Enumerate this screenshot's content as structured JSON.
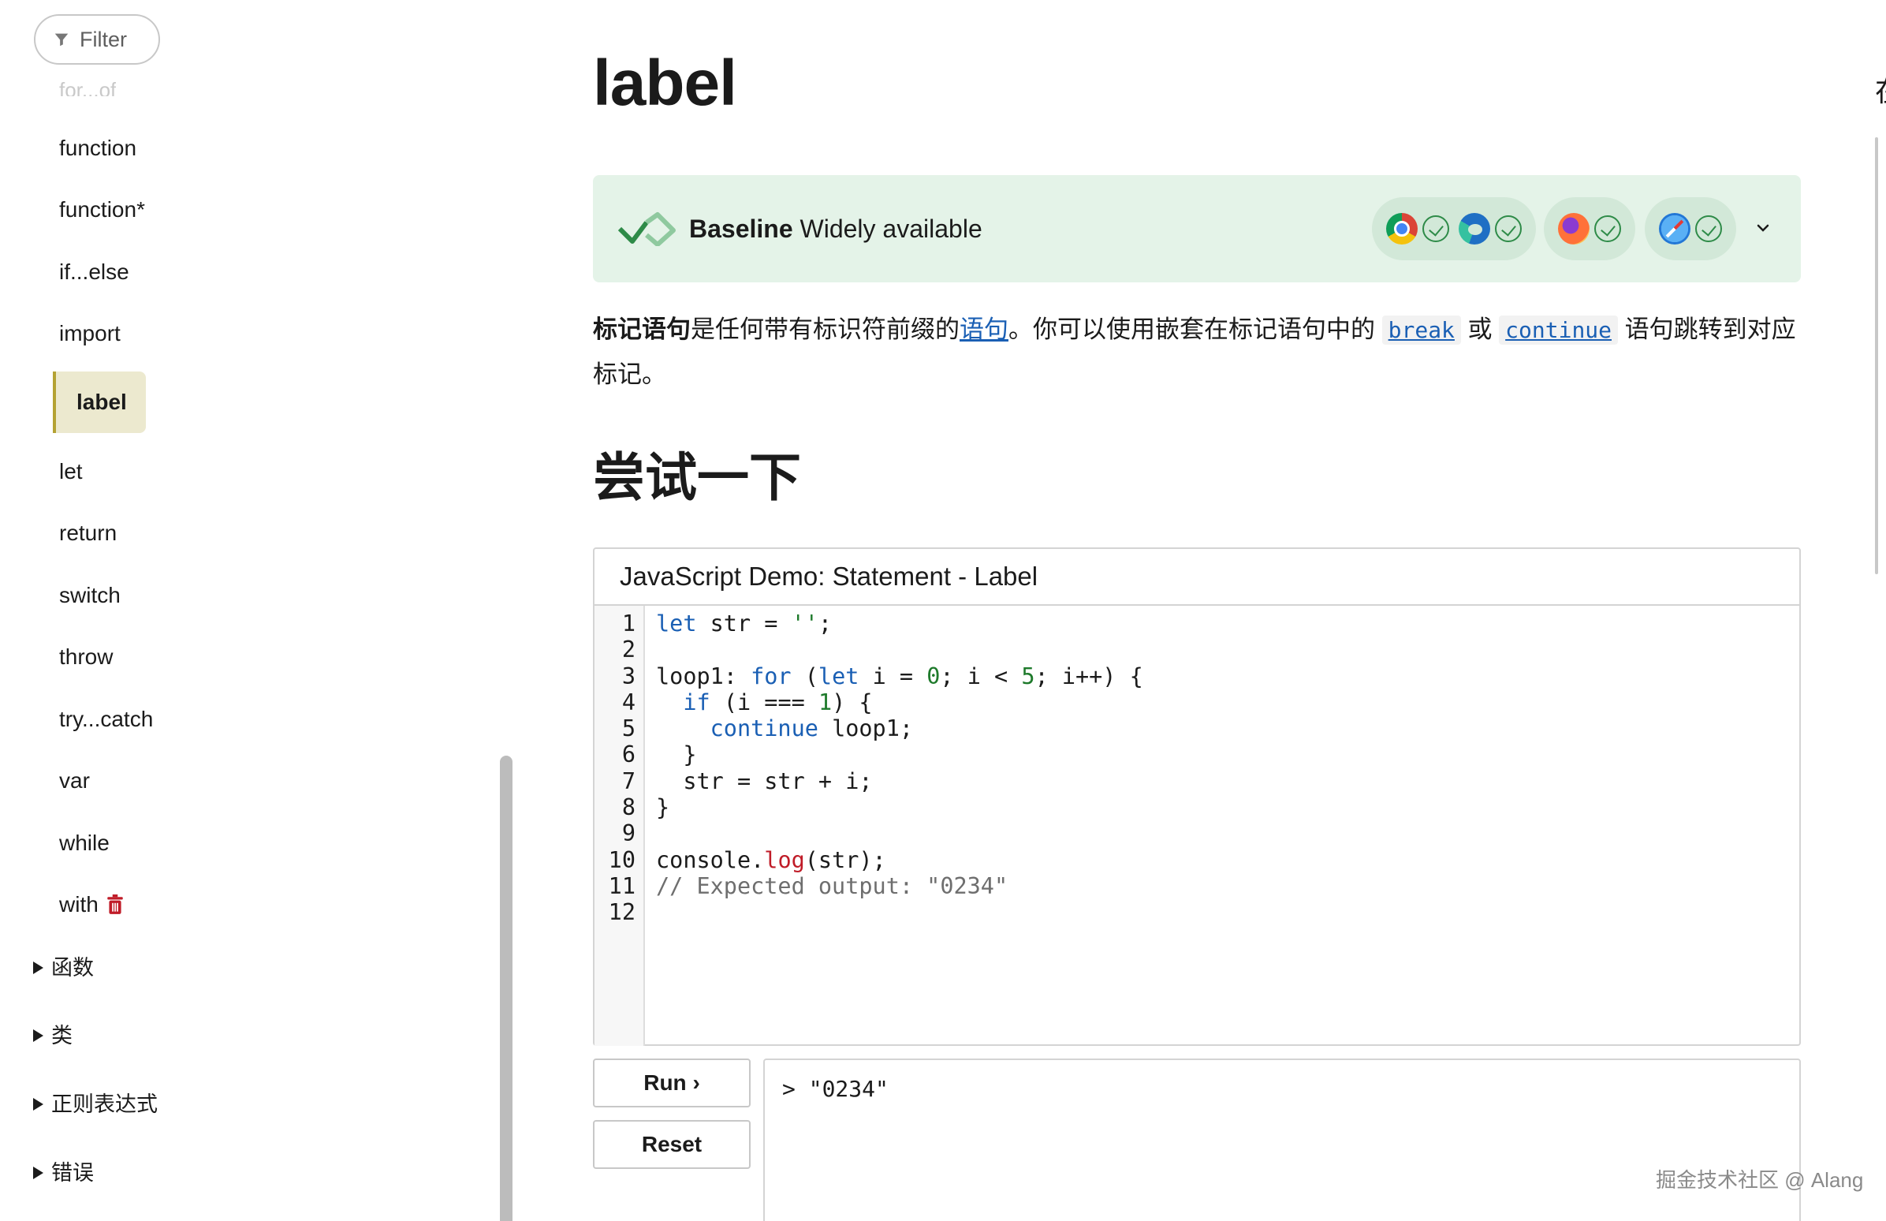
{
  "sidebar": {
    "filter_label": "Filter",
    "faded_item": "for...of",
    "items": [
      {
        "label": "function"
      },
      {
        "label": "function*"
      },
      {
        "label": "if...else"
      },
      {
        "label": "import"
      },
      {
        "label": "label",
        "active": true
      },
      {
        "label": "let"
      },
      {
        "label": "return"
      },
      {
        "label": "switch"
      },
      {
        "label": "throw"
      },
      {
        "label": "try...catch"
      },
      {
        "label": "var"
      },
      {
        "label": "while"
      },
      {
        "label": "with",
        "icon": "trash-icon",
        "icon_color": "#c01c28"
      }
    ],
    "groups": [
      {
        "label": "函数"
      },
      {
        "label": "类"
      },
      {
        "label": "正则表达式"
      },
      {
        "label": "错误"
      }
    ]
  },
  "page": {
    "title": "label",
    "edge_glyph": "在"
  },
  "baseline": {
    "strong": "Baseline",
    "text": " Widely available",
    "browsers": [
      "chrome-icon",
      "edge-icon",
      "firefox-icon",
      "safari-icon"
    ],
    "accent_color": "#2e8b48"
  },
  "intro": {
    "bold": "标记语句",
    "part1": "是任何带有标识符前缀的",
    "link_statement": "语句",
    "part2": "。你可以使用嵌套在标记语句中的 ",
    "code_break": "break",
    "part3": " 或 ",
    "code_continue": "continue",
    "part4": " 语句跳转到对应标记。"
  },
  "section": {
    "try_it": "尝试一下"
  },
  "demo": {
    "title": "JavaScript Demo: Statement - Label",
    "line_numbers": [
      "1",
      "2",
      "3",
      "4",
      "5",
      "6",
      "7",
      "8",
      "9",
      "10",
      "11",
      "12"
    ],
    "run_label": "Run ›",
    "reset_label": "Reset",
    "output": "> \"0234\""
  },
  "watermark": "掘金技术社区 @ Alang"
}
